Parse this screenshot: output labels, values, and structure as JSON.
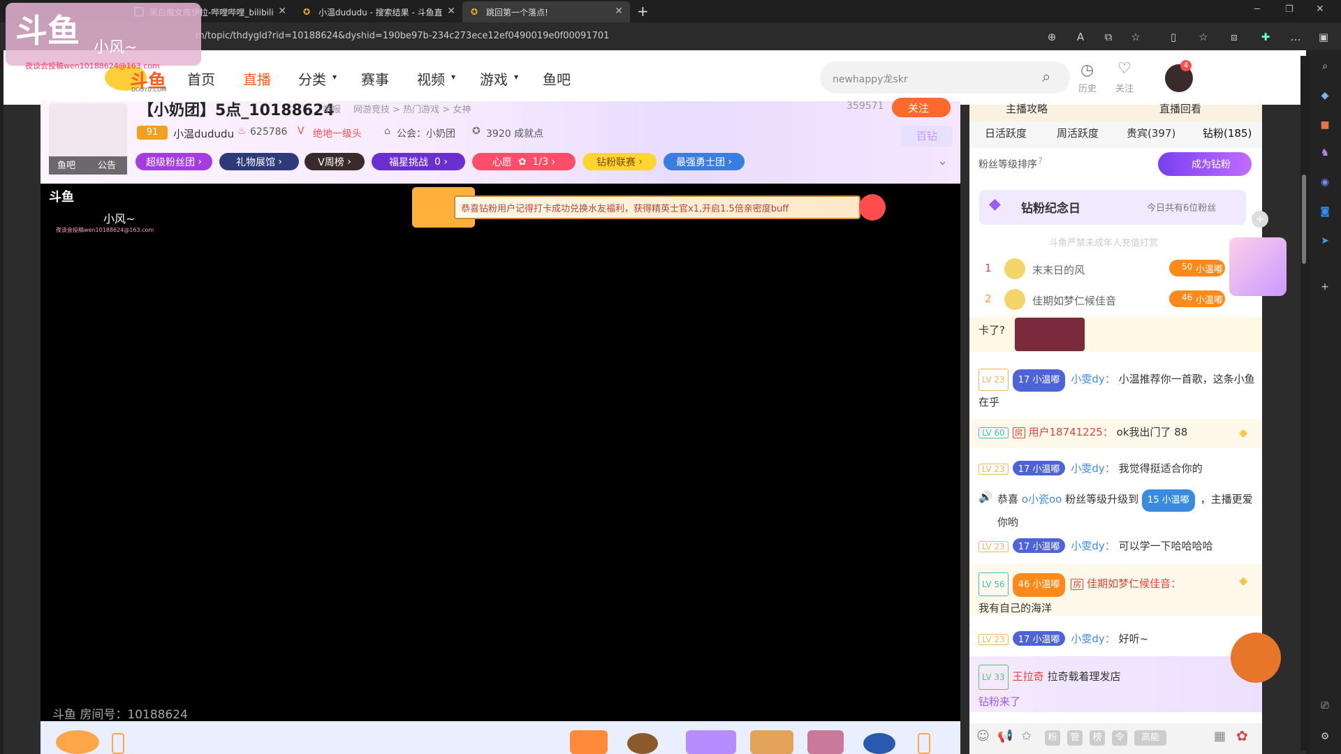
{
  "browser": {
    "tabs": [
      {
        "label": "黑白魔女库伊拉-哔哩哔哩_bilibili"
      },
      {
        "label": "小温dududu - 搜索结果 - 斗鱼直"
      },
      {
        "label": "跳回第一个落点!"
      }
    ],
    "new_tab": "+",
    "url": "m/topic/thdygld?rid=10188624&dyshid=190be97b-234c273ece12ef0490019e0f00091701"
  },
  "watermark": {
    "name": "小风~",
    "email": "夜谈会投稿wen10188624@163.com",
    "brand": "斗鱼",
    "brand_sub": "DOUYU.COM"
  },
  "header": {
    "nav": [
      "首页",
      "直播",
      "分类",
      "赛事",
      "视频",
      "游戏",
      "鱼吧"
    ],
    "search_placeholder": "newhappy龙skr",
    "history": "历史",
    "follow": "关注",
    "avatar_badge": "4"
  },
  "room": {
    "title": "【小奶团】5点_10188624",
    "report": "举报",
    "tags": "网游竞技 > 热门游戏 > 女神",
    "follow_count": "359571",
    "follow_button": "关注",
    "level": "91",
    "streamer": "小温dududu",
    "heat": "625786",
    "rank": "绝地一级头",
    "guild": "公会：小奶团",
    "achievements": "3920 成就点",
    "baizuan": "百钻",
    "avatar_labels": [
      "鱼吧",
      "公告"
    ],
    "pills": [
      "超级粉丝团",
      "礼物展馆",
      "V周榜",
      "福星挑战",
      "0",
      "心愿",
      "1/3",
      "钻粉联赛",
      "最强勇士团"
    ]
  },
  "video": {
    "banner": "恭喜钻粉用户记得打卡成功兑换水友福利，获得精英士官x1,开启1.5倍亲密度buff",
    "room_id": "斗鱼 房间号：10188624"
  },
  "right_panel": {
    "top_links": [
      "主播攻略",
      "直播回看"
    ],
    "tabs": [
      "日活跃度",
      "周活跃度",
      "贵宾(397)",
      "钻粉(185)"
    ],
    "fan_sort": "粉丝等级排序",
    "become_vip": "成为钻粉",
    "anniversary": "钻粉纪念日",
    "today": "今日共有6位粉丝",
    "notice": "斗鱼严禁未成年人充值打赏",
    "ranks": [
      {
        "no": "1",
        "name": "末末日的风",
        "level": "50",
        "badge": "小温嘟"
      },
      {
        "no": "2",
        "name": "佳期如梦仁候佳音",
        "level": "46",
        "badge": "小温嘟"
      }
    ],
    "chat": [
      {
        "text": "卡了?"
      },
      {
        "lv": "LV 23",
        "fan_lv": "17",
        "badge": "小温嘟",
        "user": "小雯dy：",
        "msg": "小温推荐你一首歌，这条小鱼在乎"
      },
      {
        "lv": "LV 60",
        "fang": "房",
        "user": "用户18741225：",
        "msg": "ok我出门了 88"
      },
      {
        "lv": "LV 23",
        "fan_lv": "17",
        "badge": "小温嘟",
        "user": "小雯dy：",
        "msg": "我觉得挺适合你的"
      },
      {
        "sys": "恭喜",
        "user": "o小瓷oo",
        "mid": "粉丝等级升级到",
        "fan_lv": "15",
        "badge": "小温嘟",
        "tail": "，主播更爱你哟"
      },
      {
        "lv": "LV 23",
        "fan_lv": "17",
        "badge": "小温嘟",
        "user": "小雯dy：",
        "msg": "可以学一下哈哈哈哈"
      },
      {
        "lv": "LV 56",
        "fan_lv": "46",
        "badge": "小温嘟",
        "fang": "房",
        "user": "佳期如梦仁候佳音：",
        "msg": "我有自己的海洋"
      },
      {
        "lv": "LV 23",
        "fan_lv": "17",
        "badge": "小温嘟",
        "user": "小雯dy：",
        "msg": "好听~"
      },
      {
        "lv": "LV 33",
        "user": "王拉奇",
        "msg": "拉奇载着理发店",
        "tail": "钻粉来了"
      }
    ],
    "toolbar": [
      "粉",
      "管",
      "榜",
      "令",
      "高能"
    ]
  },
  "colors": {
    "accent": "#ff5d23",
    "nav_active": "#ff5d23",
    "purple": "#8a3bd8"
  }
}
